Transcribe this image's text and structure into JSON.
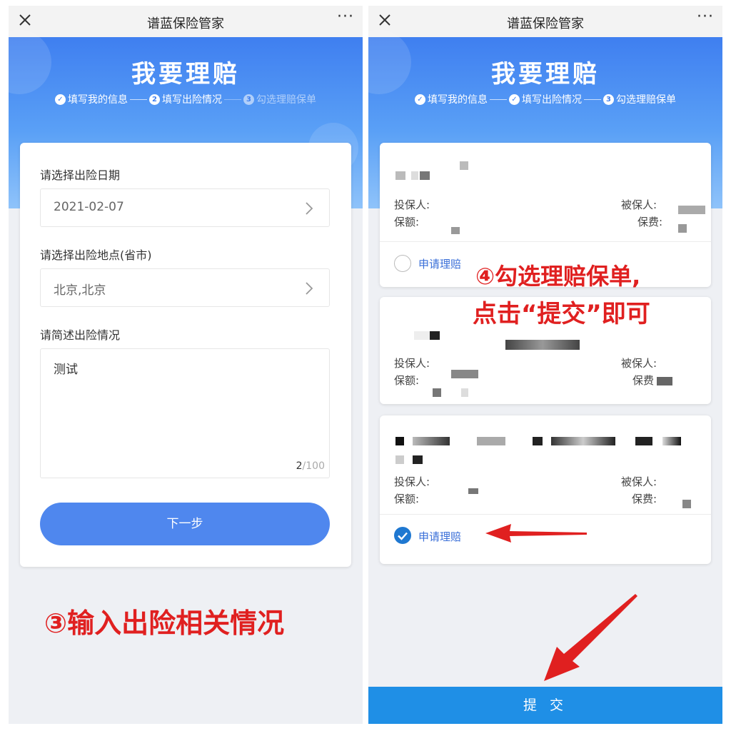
{
  "left_screen": {
    "titlebar": {
      "close_icon": "close-icon",
      "title": "谱蓝保险管家",
      "more": "···"
    },
    "banner": {
      "title": "我要理赔",
      "steps": [
        {
          "marker": "✓",
          "label": "填写我的信息",
          "state": "done"
        },
        {
          "marker": "2",
          "label": "填写出险情况",
          "state": "current"
        },
        {
          "marker": "3",
          "label": "勾选理赔保单",
          "state": "pending"
        }
      ]
    },
    "form": {
      "date_label": "请选择出险日期",
      "date_value": "2021-02-07",
      "place_label": "请选择出险地点(省市)",
      "place_value": "北京,北京",
      "desc_label": "请简述出险情况",
      "desc_value": "测试",
      "desc_count": "2",
      "desc_max": "/100",
      "next_button": "下一步"
    },
    "annotation": "③输入出险相关情况"
  },
  "right_screen": {
    "titlebar": {
      "close_icon": "close-icon",
      "title": "谱蓝保险管家",
      "more": "···"
    },
    "banner": {
      "title": "我要理赔",
      "steps": [
        {
          "marker": "✓",
          "label": "填写我的信息",
          "state": "done"
        },
        {
          "marker": "✓",
          "label": "填写出险情况",
          "state": "done"
        },
        {
          "marker": "3",
          "label": "勾选理赔保单",
          "state": "current"
        }
      ]
    },
    "policies": [
      {
        "policyholder_label": "投保人:",
        "insured_label": "被保人:",
        "amount_label": "保额:",
        "premium_label": "保费:",
        "apply_label": "申请理赔",
        "selected": false
      },
      {
        "policyholder_label": "投保人:",
        "insured_label": "被保人:",
        "amount_label": "保额:",
        "premium_label": "保费"
      },
      {
        "policyholder_label": "投保人:",
        "insured_label": "被保人:",
        "amount_label": "保额:",
        "premium_label": "保费:",
        "apply_label": "申请理赔",
        "selected": true
      }
    ],
    "annotation_line1": "④勾选理赔保单,",
    "annotation_line2": "点击“提交”即可",
    "submit_button": "提 交"
  },
  "colors": {
    "brand_blue": "#4f87ee",
    "submit_blue": "#1f8fe6",
    "annotation_red": "#e02020",
    "link_blue": "#3a6fd8"
  }
}
